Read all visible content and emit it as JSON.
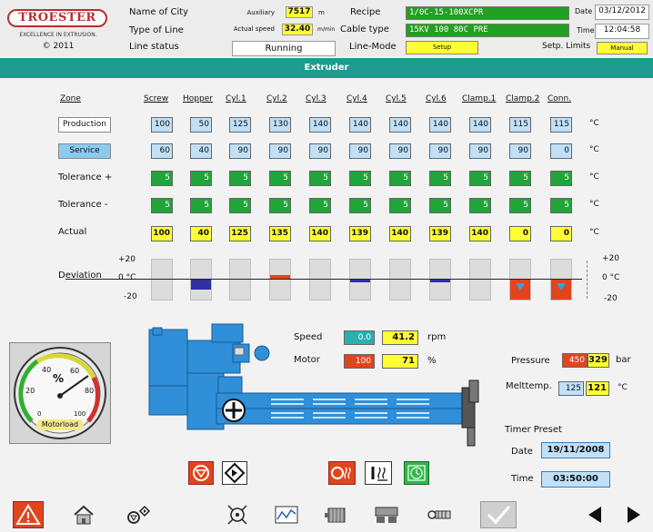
{
  "header": {
    "logo": "TROESTER",
    "logo_sub": "EXCELLENCE IN EXTRUSION.",
    "copyright": "© 2011",
    "name_of_city": "Name of City",
    "type_of_line": "Type of Line",
    "line_status_label": "Line status",
    "line_status": "Running",
    "auxiliary_label": "Auxiliary",
    "auxiliary_value": "7517",
    "auxiliary_unit": "m",
    "actual_speed_label": "Actual speed",
    "actual_speed_value": "32.40",
    "actual_speed_unit": "m/min",
    "recipe_label": "Recipe",
    "recipe_value": "1/0C-15-100XCPR",
    "cable_type_label": "Cable type",
    "cable_type_value": "15KV 100 80C PRE",
    "line_mode_label": "Line-Mode",
    "setup_btn": "Setup",
    "date_label": "Date",
    "date_value": "03/12/2012",
    "time_label": "Time",
    "time_value": "12:04:58",
    "setp_limits_label": "Setp. Limits",
    "manual_btn": "Manual"
  },
  "section_title": "Extruder",
  "zones": {
    "zone_label": "Zone",
    "columns": [
      "Screw",
      "Hopper",
      "Cyl.1",
      "Cyl.2",
      "Cyl.3",
      "Cyl.4",
      "Cyl.5",
      "Cyl.6",
      "Clamp.1",
      "Clamp.2",
      "Conn."
    ],
    "production_btn": "Production",
    "service_btn": "Service",
    "tol_plus_label": "Tolerance +",
    "tol_minus_label": "Tolerance -",
    "actual_label": "Actual",
    "deviation_label": "Deviation",
    "production": [
      "100",
      "50",
      "125",
      "130",
      "140",
      "140",
      "140",
      "140",
      "140",
      "115",
      "115"
    ],
    "service": [
      "60",
      "40",
      "90",
      "90",
      "90",
      "90",
      "90",
      "90",
      "90",
      "90",
      "0"
    ],
    "tol_plus": [
      "5",
      "5",
      "5",
      "5",
      "5",
      "5",
      "5",
      "5",
      "5",
      "5",
      "5"
    ],
    "tol_minus": [
      "5",
      "5",
      "5",
      "5",
      "5",
      "5",
      "5",
      "5",
      "5",
      "5",
      "5"
    ],
    "actual": [
      "100",
      "40",
      "125",
      "135",
      "140",
      "139",
      "140",
      "139",
      "140",
      "0",
      "0"
    ],
    "unit": "°C",
    "dev_plus": "+20",
    "dev_zero": "0 °C",
    "dev_minus": "-20"
  },
  "machine": {
    "motorload_label": "Motorload",
    "gauge_percent": "%",
    "gauge_ticks": [
      "0",
      "20",
      "40",
      "60",
      "80",
      "100"
    ],
    "speed_label": "Speed",
    "speed_set": "0.0",
    "speed_actual": "41.2",
    "speed_unit": "rpm",
    "motor_label": "Motor",
    "motor_set": "100",
    "motor_actual": "71",
    "motor_unit": "%",
    "pressure_label": "Pressure",
    "pressure_set": "450",
    "pressure_actual": "329",
    "pressure_unit": "bar",
    "melttemp_label": "Melttemp.",
    "melttemp_set": "125",
    "melttemp_actual": "121",
    "melttemp_unit": "°C",
    "timer_preset_label": "Timer Preset",
    "timer_date_label": "Date",
    "timer_date_value": "19/11/2008",
    "timer_time_label": "Time",
    "timer_time_value": "03:50:00"
  }
}
